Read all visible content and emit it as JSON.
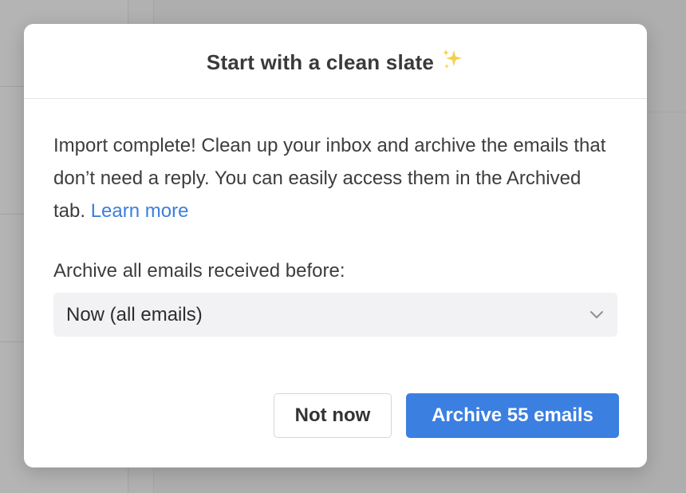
{
  "modal": {
    "title": "Start with a clean slate",
    "title_icon": "sparkles-icon",
    "description": "Import complete! Clean up your inbox and archive the emails that don’t need a reply. You can easily access them in the Archived tab.",
    "learn_more_label": "Learn more",
    "select_label": "Archive all emails received before:",
    "select_value": "Now (all emails)",
    "secondary_button_label": "Not now",
    "primary_button_label": "Archive 55 emails"
  },
  "colors": {
    "accent": "#3b7fe0",
    "link": "#3b7fdc",
    "sparkle": "#f2c744",
    "overlay": "#aeaeae"
  }
}
